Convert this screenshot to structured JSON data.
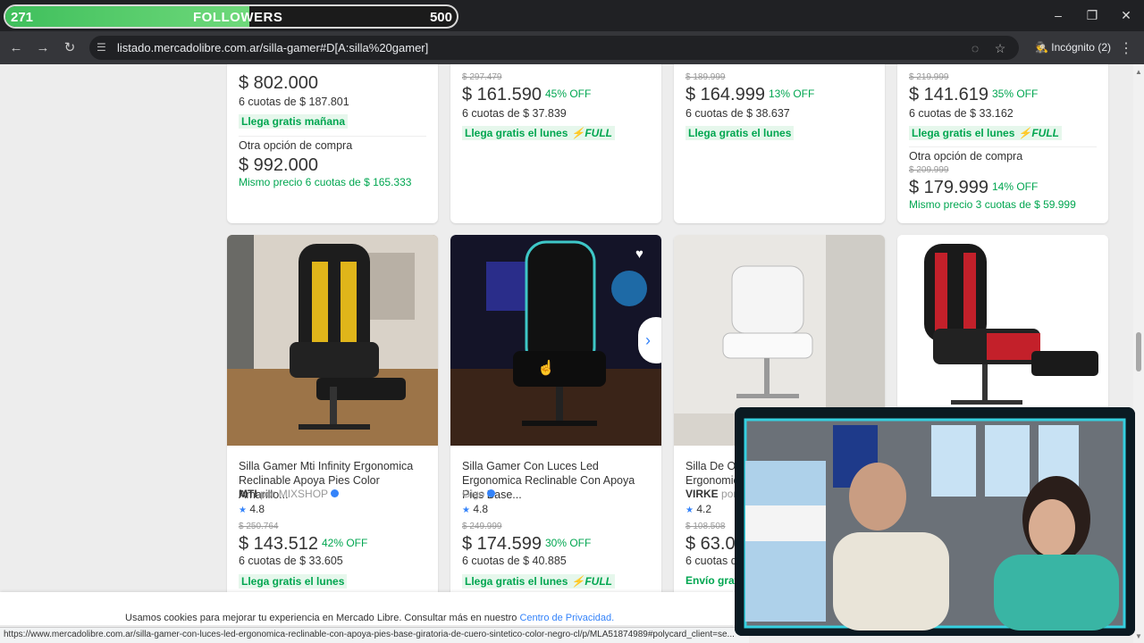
{
  "overlay": {
    "followers_current": "271",
    "followers_label": "FOLLOWERS",
    "followers_goal": "500",
    "progress": 0.54
  },
  "browser": {
    "url": "listado.mercadolibre.com.ar/silla-gamer#D[A:silla%20gamer]",
    "incognito": "Incógnito (2)",
    "status_url": "https://www.mercadolibre.com.ar/silla-gamer-con-luces-led-ergonomica-reclinable-con-apoya-pies-base-giratoria-de-cuero-sintetico-color-negro-cl/p/MLA51874989#polycard_client=se..."
  },
  "top_row": [
    {
      "price": "$ 802.000",
      "installments": "6 cuotas de $ 187.801",
      "shipping": "Llega gratis mañana",
      "other_option": "Otra opción de compra",
      "other_price": "$ 992.000",
      "same_price": "Mismo precio 6 cuotas de $ 165.333"
    },
    {
      "old_price": "$ 297.479",
      "price": "$ 161.590",
      "discount": "45% OFF",
      "installments": "6 cuotas de $ 37.839",
      "shipping": "Llega gratis el lunes",
      "full": "⚡FULL"
    },
    {
      "old_price": "$ 189.999",
      "price": "$ 164.999",
      "discount": "13% OFF",
      "installments": "6 cuotas de $ 38.637",
      "shipping": "Llega gratis el lunes"
    },
    {
      "old_price": "$ 219.999",
      "price": "$ 141.619",
      "discount": "35% OFF",
      "installments": "6 cuotas de $ 33.162",
      "shipping": "Llega gratis el lunes",
      "full": "⚡FULL",
      "other_option": "Otra opción de compra",
      "other_old_price": "$ 209.999",
      "other_price": "$ 179.999",
      "other_discount": "14% OFF",
      "same_price": "Mismo precio 3 cuotas de $ 59.999"
    }
  ],
  "bottom_row": [
    {
      "title": "Silla Gamer Mti Infinity Ergonomica Reclinable Apoya Pies Color Amarillo...",
      "brand": "MTI",
      "seller": "por MIXSHOP",
      "rating": "4.8",
      "old_price": "$ 250.764",
      "price": "$ 143.512",
      "discount": "42% OFF",
      "installments": "6 cuotas de $ 33.605",
      "shipping": "Llega gratis el lunes"
    },
    {
      "title": "Silla Gamer Con Luces Led Ergonomica Reclinable Con Apoya Pies Base...",
      "seller": "Gigo",
      "rating": "4.8",
      "old_price": "$ 249.999",
      "price": "$ 174.599",
      "discount": "30% OFF",
      "installments": "6 cuotas de $ 40.885",
      "shipping": "Llega gratis el lunes",
      "full": "⚡FULL"
    },
    {
      "title": "Silla De Of\nErgonomic",
      "brand": "VIRKE",
      "seller": "por",
      "rating": "4.2",
      "old_price": "$ 108.508",
      "price": "$ 63.0",
      "installments": "6 cuotas d",
      "shipping": "Envío grati"
    }
  ],
  "cookie": {
    "text": "Usamos cookies para mejorar tu experiencia en Mercado Libre. Consultar más en nuestro ",
    "link": "Centro de Privacidad."
  }
}
